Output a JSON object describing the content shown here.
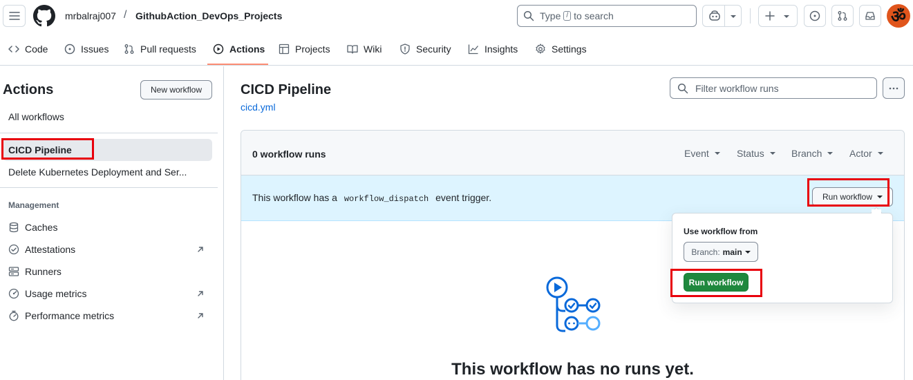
{
  "header": {
    "owner": "mrbalraj007",
    "separator": "/",
    "repo": "GithubAction_DevOps_Projects",
    "search": {
      "prefix": "Type",
      "key": "/",
      "suffix": "to search"
    },
    "avatar_glyph": "ॐ"
  },
  "repo_nav": [
    {
      "label": "Code",
      "icon": "code-icon"
    },
    {
      "label": "Issues",
      "icon": "issue-opened-icon"
    },
    {
      "label": "Pull requests",
      "icon": "git-pull-request-icon"
    },
    {
      "label": "Actions",
      "icon": "play-icon",
      "active": true
    },
    {
      "label": "Projects",
      "icon": "table-icon"
    },
    {
      "label": "Wiki",
      "icon": "book-icon"
    },
    {
      "label": "Security",
      "icon": "shield-icon"
    },
    {
      "label": "Insights",
      "icon": "graph-icon"
    },
    {
      "label": "Settings",
      "icon": "gear-icon"
    }
  ],
  "sidebar": {
    "title": "Actions",
    "new_workflow": "New workflow",
    "all_workflows": "All workflows",
    "workflows": [
      {
        "label": "CICD Pipeline",
        "selected": true
      },
      {
        "label": "Delete Kubernetes Deployment and Ser..."
      }
    ],
    "management_label": "Management",
    "management": [
      {
        "label": "Caches",
        "icon": "database-icon",
        "external": false
      },
      {
        "label": "Attestations",
        "icon": "verified-icon",
        "external": true
      },
      {
        "label": "Runners",
        "icon": "server-icon",
        "external": false
      },
      {
        "label": "Usage metrics",
        "icon": "meter-icon",
        "external": true
      },
      {
        "label": "Performance metrics",
        "icon": "stopwatch-icon",
        "external": true
      }
    ]
  },
  "main": {
    "title": "CICD Pipeline",
    "file": "cicd.yml",
    "filter_placeholder": "Filter workflow runs",
    "runs_count": "0 workflow runs",
    "filters": [
      "Event",
      "Status",
      "Branch",
      "Actor"
    ],
    "dispatch": {
      "before": "This workflow has a",
      "code": "workflow_dispatch",
      "after": "event trigger."
    },
    "run_workflow": "Run workflow",
    "empty_title": "This workflow has no runs yet."
  },
  "popover": {
    "title": "Use workflow from",
    "branch_label": "Branch:",
    "branch_value": "main",
    "run_button": "Run workflow"
  },
  "colors": {
    "accent": "#0969da",
    "primary_green": "#1f883d",
    "highlight_red": "#e8000b",
    "dispatch_bg": "#ddf4ff",
    "nav_underline": "#fd8c73"
  }
}
